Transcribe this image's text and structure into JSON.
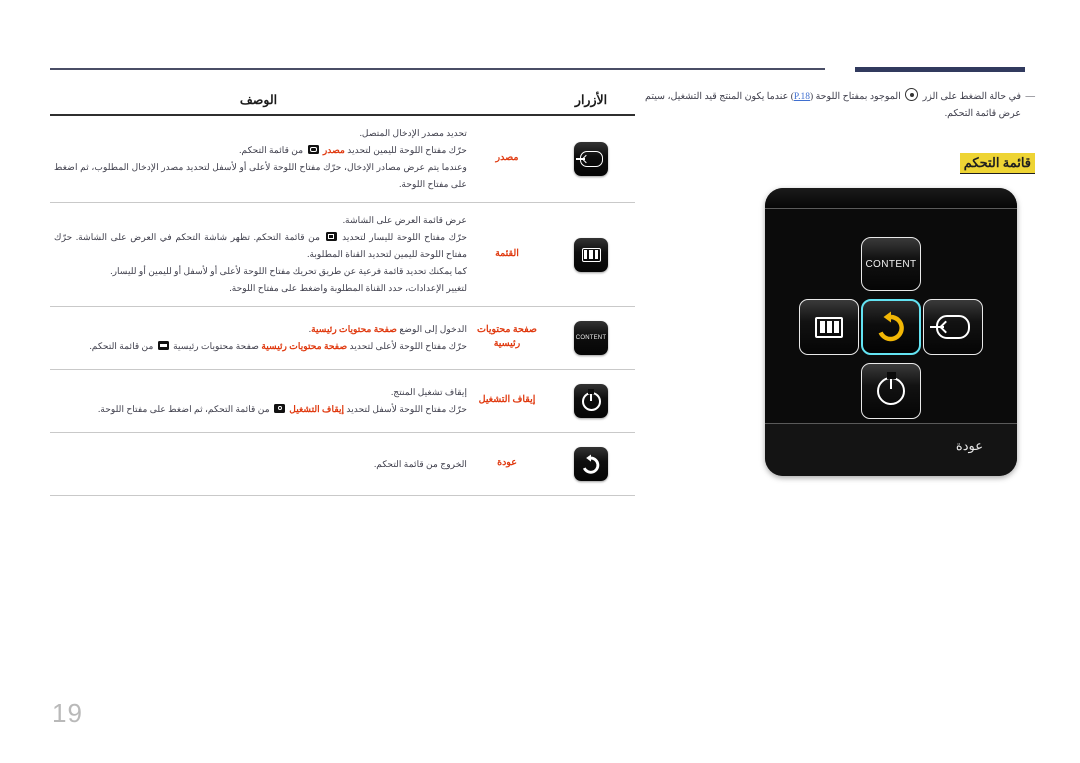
{
  "page": {
    "number": "19",
    "note": {
      "dash": "—",
      "before": "في حالة الضغط على الزر",
      "icon": "circle-dot-icon",
      "after_icon": "الموجود بمفتاح اللوحة (",
      "link": "P.18",
      "after_link": ") عندما يكون المنتج قيد التشغيل، سيتم عرض قائمة التحكم."
    },
    "control_menu_title": "قائمة التحكم"
  },
  "panel": {
    "keys": {
      "content": {
        "label": "CONTENT",
        "icon": "content-key"
      },
      "menu": {
        "icon": "menu-bars-icon"
      },
      "return": {
        "icon": "return-arrow-icon",
        "highlighted": true
      },
      "source": {
        "icon": "source-input-icon"
      },
      "power": {
        "icon": "power-icon"
      }
    },
    "footer_label": "عودة",
    "highlight_color": "#63e3f2",
    "return_arrow_color": "#f2b705"
  },
  "table": {
    "headers": {
      "buttons": "الأزرار",
      "label": "",
      "description": "الوصف"
    },
    "rows": [
      {
        "icon": "source-input-icon",
        "label": "مصدر",
        "lines": [
          "تحديد مصدر الإدخال المتصل.",
          "حرّك مفتاح اللوحة لليمين لتحديد |مصدر| [src] من قائمة التحكم.",
          "وعندما يتم عرض مصادر الإدخال، حرّك مفتاح اللوحة لأعلى أو لأسفل لتحديد مصدر الإدخال المطلوب، ثم اضغط على مفتاح اللوحة."
        ]
      },
      {
        "icon": "menu-bars-icon",
        "label": "القئمة",
        "lines": [
          "عرض قائمة العرض على الشاشة.",
          "حرّك مفتاح اللوحة لليسار لتحديد [bars] من قائمة التحكم. تظهر شاشة التحكم في العرض على الشاشة. حرّك مفتاح اللوحة لليمين لتحديد القناة المطلوبة.",
          "كما يمكنك تحديد قائمة فرعية عن طريق تحريك مفتاح اللوحة لأعلى أو لأسفل أو لليمين أو لليسار.",
          "لتغيير الإعدادات، حدد القناة المطلوبة واضغط على مفتاح اللوحة."
        ]
      },
      {
        "icon": "content-key",
        "label": "صفحة محتويات\nرئيسية",
        "lines": [
          "الدخول إلى الوضع |صفحة محتويات رئيسية|.",
          "حرّك مفتاح اللوحة لأعلى لتحديد |صفحة محتويات رئيسية| صفحة محتويات رئيسية [solid] من قائمة التحكم."
        ]
      },
      {
        "icon": "power-icon",
        "label": "إيقاف التشغيل",
        "lines": [
          "إيقاف تشغيل المنتج.",
          "حرّك مفتاح اللوحة لأسفل لتحديد |إيقاف التشغيل| [pwr] من قائمة التحكم، ثم اضغط على مفتاح اللوحة."
        ]
      },
      {
        "icon": "return-arrow-icon",
        "label": "عودة",
        "lines": [
          "الخروج من قائمة التحكم."
        ]
      }
    ]
  },
  "colors": {
    "accent_red": "#e03a10",
    "highlight_yellow": "#eed434",
    "link_blue": "#3f6fd0",
    "navy_bar": "#313a5e"
  }
}
